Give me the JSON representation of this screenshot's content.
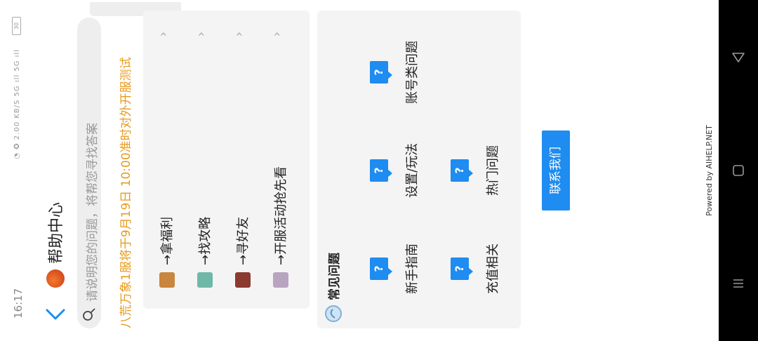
{
  "status": {
    "time": "16:17",
    "icons": "◔ ✪ 2.00 KB/S 5G ıll 5G ıll",
    "battery": "30"
  },
  "header": {
    "title": "帮助中心"
  },
  "search": {
    "placeholder": "请说明您的问题，将帮您寻找答案"
  },
  "announcement": "八荒万象1服将于9月19日 10:00准时对外开服测试",
  "quick_links": [
    {
      "label": "→拿福利",
      "avatar_color": "#c8863e"
    },
    {
      "label": "→找攻略",
      "avatar_color": "#6fb8a8"
    },
    {
      "label": "→寻好友",
      "avatar_color": "#8a3a2e"
    },
    {
      "label": "→开服活动抢先看",
      "avatar_color": "#b9a4c0"
    }
  ],
  "faq": {
    "title": "常见问题",
    "items": [
      "新手指南",
      "设置/玩法",
      "账号类问题",
      "充值相关",
      "热门问题"
    ]
  },
  "contact_button": "联系我们",
  "powered_by": "Powered by AIHELP.NET",
  "colors": {
    "accent": "#1e8cf0",
    "announcement": "#e89a1b"
  }
}
